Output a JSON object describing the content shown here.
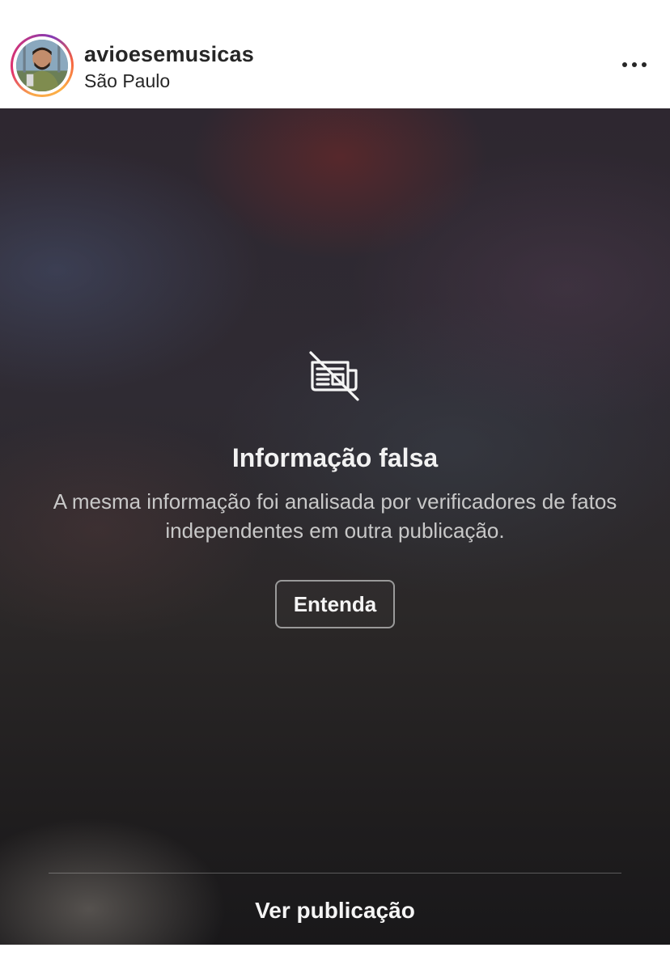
{
  "post_header": {
    "username": "avioesemusicas",
    "location": "São Paulo",
    "more_icon": "more-horizontal-icon"
  },
  "warning_overlay": {
    "icon": "newspaper-slash-icon",
    "title": "Informação falsa",
    "description": "A mesma informação foi analisada por verificadores de fatos independentes em outra publicação.",
    "learn_more_label": "Entenda",
    "view_post_label": "Ver publicação"
  }
}
